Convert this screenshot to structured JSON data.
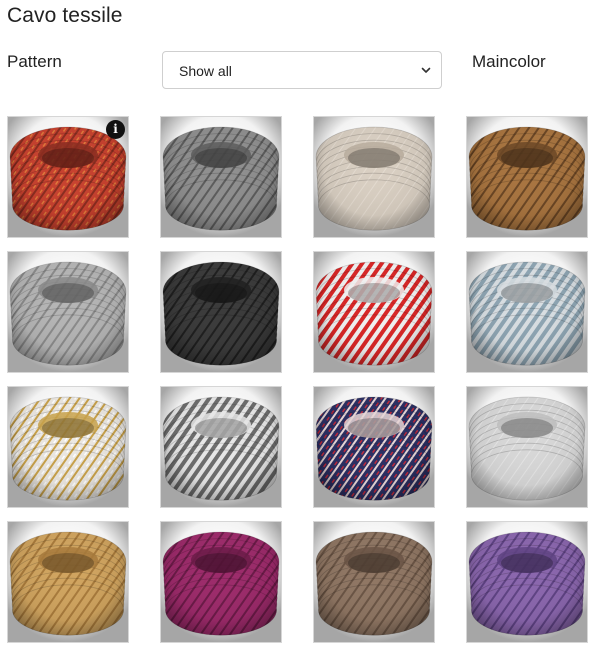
{
  "title": "Cavo tessile",
  "filters": {
    "pattern_label": "Pattern",
    "pattern_select_value": "Show all",
    "maincolor_label": "Maincolor"
  },
  "products": [
    {
      "primary": "#c8412e",
      "secondary": "#8a2c1f",
      "accent": "#e07a3a",
      "pattern": "mixed",
      "info": true
    },
    {
      "primary": "#8f8f8f",
      "secondary": "#5c5c5c",
      "accent": "#c9c9c9",
      "pattern": "stripe",
      "info": false
    },
    {
      "primary": "#d9cfc2",
      "secondary": "#b9ad9d",
      "accent": "#efe8de",
      "pattern": "solid",
      "info": false
    },
    {
      "primary": "#a8743f",
      "secondary": "#6b4624",
      "accent": "#d1a36a",
      "pattern": "stripe",
      "info": false
    },
    {
      "primary": "#b5b5b5",
      "secondary": "#8a8a8a",
      "accent": "#e2e2e2",
      "pattern": "stripe",
      "info": false
    },
    {
      "primary": "#3a3a3a",
      "secondary": "#1e1e1e",
      "accent": "#6e6e6e",
      "pattern": "stripe",
      "info": false
    },
    {
      "primary": "#d92626",
      "secondary": "#f2f2f2",
      "accent": "#8f1414",
      "pattern": "candy",
      "info": false
    },
    {
      "primary": "#8ea5b3",
      "secondary": "#d9dfe3",
      "accent": "#5b7483",
      "pattern": "candy",
      "info": false
    },
    {
      "primary": "#ece8e2",
      "secondary": "#c9a24a",
      "accent": "#ffffff",
      "pattern": "dash",
      "info": false
    },
    {
      "primary": "#6d6d6d",
      "secondary": "#e8e8e8",
      "accent": "#3a3a3a",
      "pattern": "candy",
      "info": false
    },
    {
      "primary": "#2b2f63",
      "secondary": "#e9d7d7",
      "accent": "#c2283a",
      "pattern": "mixed",
      "info": false
    },
    {
      "primary": "#d8d8d8",
      "secondary": "#bfbfbf",
      "accent": "#f1f1f1",
      "pattern": "solid",
      "info": false
    },
    {
      "primary": "#d0a45f",
      "secondary": "#a87a3b",
      "accent": "#e8c38a",
      "pattern": "stripe",
      "info": false
    },
    {
      "primary": "#9c2a6a",
      "secondary": "#6b1a47",
      "accent": "#c24f8e",
      "pattern": "stripe",
      "info": false
    },
    {
      "primary": "#8f7663",
      "secondary": "#6a5444",
      "accent": "#b49b86",
      "pattern": "stripe",
      "info": false
    },
    {
      "primary": "#8a66ad",
      "secondary": "#5e4283",
      "accent": "#b393d1",
      "pattern": "stripe",
      "info": false
    }
  ]
}
